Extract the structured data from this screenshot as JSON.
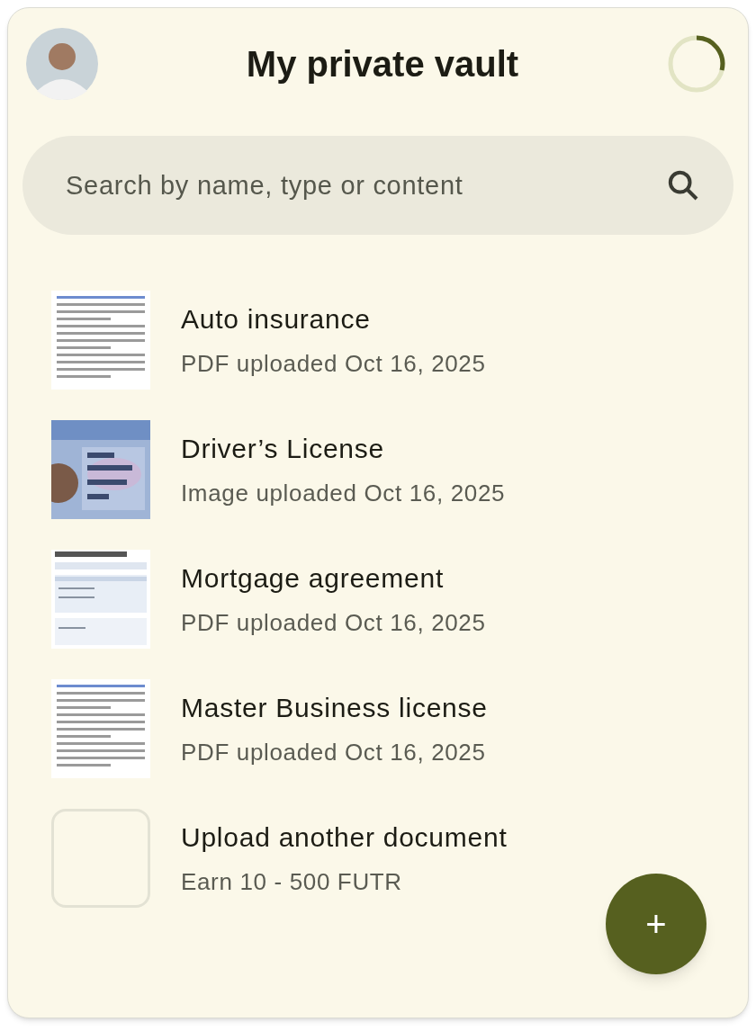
{
  "header": {
    "title": "My private vault"
  },
  "search": {
    "placeholder": "Search by name, type or content"
  },
  "documents": [
    {
      "kind": "pdf",
      "title": "Auto insurance",
      "subtitle": "PDF uploaded Oct 16, 2025"
    },
    {
      "title": "Driver’s License",
      "subtitle": "Image uploaded Oct 16, 2025"
    },
    {
      "kind": "table",
      "title": "Mortgage agreement",
      "subtitle": "PDF uploaded Oct 16, 2025"
    },
    {
      "kind": "pdf",
      "title": "Master Business license",
      "subtitle": "PDF uploaded Oct 16, 2025"
    }
  ],
  "upload": {
    "title": "Upload another document",
    "subtitle": "Earn 10 - 500 FUTR"
  },
  "fab": {
    "label": "+"
  }
}
